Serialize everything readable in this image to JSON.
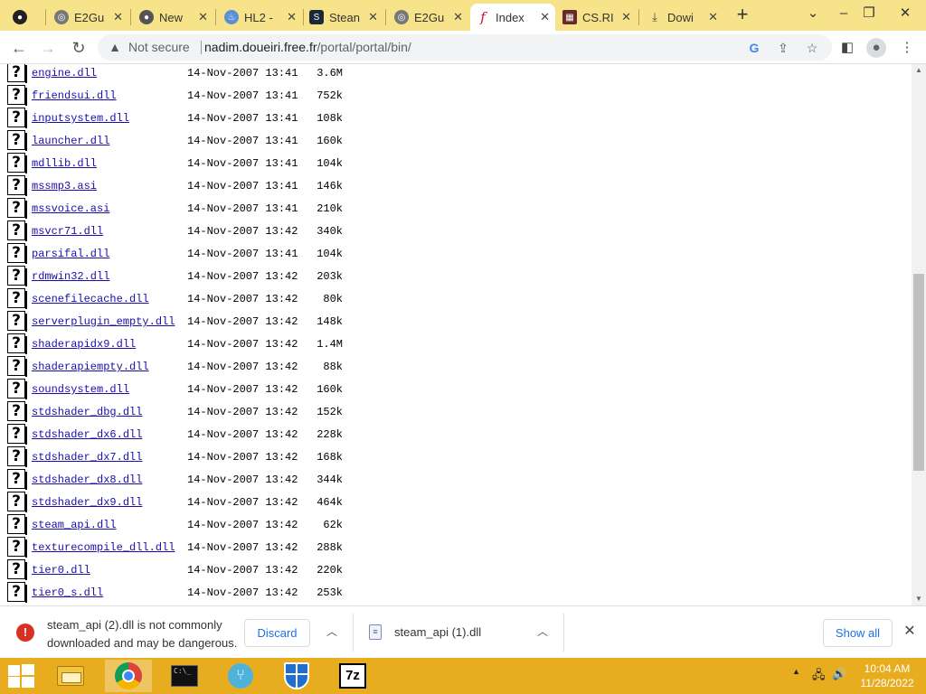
{
  "browser": {
    "tabs": [
      {
        "title": "",
        "icon": "github-icon"
      },
      {
        "title": "E2Gu",
        "icon": "globe-icon"
      },
      {
        "title": "New",
        "icon": "github-icon"
      },
      {
        "title": "HL2 -",
        "icon": "flame-icon"
      },
      {
        "title": "Stean",
        "icon": "steam-icon"
      },
      {
        "title": "E2Gu",
        "icon": "globe-icon"
      },
      {
        "title": "Index",
        "icon": "f-icon"
      },
      {
        "title": "CS.RI",
        "icon": "film-icon"
      },
      {
        "title": "Dowi",
        "icon": "download-icon"
      }
    ],
    "active_tab_index": 6,
    "new_tab_label": "+",
    "address": {
      "security": "Not secure",
      "host": "nadim.doueiri.free.fr",
      "path": "/portal/portal/bin/"
    }
  },
  "listing": [
    {
      "name": "engine.dll",
      "date": "14-Nov-2007 13:41",
      "size": "3.6M"
    },
    {
      "name": "friendsui.dll",
      "date": "14-Nov-2007 13:41",
      "size": "752k"
    },
    {
      "name": "inputsystem.dll",
      "date": "14-Nov-2007 13:41",
      "size": "108k"
    },
    {
      "name": "launcher.dll",
      "date": "14-Nov-2007 13:41",
      "size": "160k"
    },
    {
      "name": "mdllib.dll",
      "date": "14-Nov-2007 13:41",
      "size": "104k"
    },
    {
      "name": "mssmp3.asi",
      "date": "14-Nov-2007 13:41",
      "size": "146k"
    },
    {
      "name": "mssvoice.asi",
      "date": "14-Nov-2007 13:41",
      "size": "210k"
    },
    {
      "name": "msvcr71.dll",
      "date": "14-Nov-2007 13:42",
      "size": "340k"
    },
    {
      "name": "parsifal.dll",
      "date": "14-Nov-2007 13:41",
      "size": "104k"
    },
    {
      "name": "rdmwin32.dll",
      "date": "14-Nov-2007 13:42",
      "size": "203k"
    },
    {
      "name": "scenefilecache.dll",
      "date": "14-Nov-2007 13:42",
      "size": "80k"
    },
    {
      "name": "serverplugin_empty.dll",
      "date": "14-Nov-2007 13:42",
      "size": "148k"
    },
    {
      "name": "shaderapidx9.dll",
      "date": "14-Nov-2007 13:42",
      "size": "1.4M"
    },
    {
      "name": "shaderapiempty.dll",
      "date": "14-Nov-2007 13:42",
      "size": "88k"
    },
    {
      "name": "soundsystem.dll",
      "date": "14-Nov-2007 13:42",
      "size": "160k"
    },
    {
      "name": "stdshader_dbg.dll",
      "date": "14-Nov-2007 13:42",
      "size": "152k"
    },
    {
      "name": "stdshader_dx6.dll",
      "date": "14-Nov-2007 13:42",
      "size": "228k"
    },
    {
      "name": "stdshader_dx7.dll",
      "date": "14-Nov-2007 13:42",
      "size": "168k"
    },
    {
      "name": "stdshader_dx8.dll",
      "date": "14-Nov-2007 13:42",
      "size": "344k"
    },
    {
      "name": "stdshader_dx9.dll",
      "date": "14-Nov-2007 13:42",
      "size": "464k"
    },
    {
      "name": "steam_api.dll",
      "date": "14-Nov-2007 13:42",
      "size": "62k"
    },
    {
      "name": "texturecompile_dll.dll",
      "date": "14-Nov-2007 13:42",
      "size": "288k"
    },
    {
      "name": "tier0.dll",
      "date": "14-Nov-2007 13:42",
      "size": "220k"
    },
    {
      "name": "tier0_s.dll",
      "date": "14-Nov-2007 13:42",
      "size": "253k"
    }
  ],
  "downloads": {
    "warning_line1": "steam_api (2).dll is not commonly",
    "warning_line2": "downloaded and may be dangerous.",
    "discard_label": "Discard",
    "file_name": "steam_api (1).dll",
    "show_all_label": "Show all"
  },
  "taskbar": {
    "time": "10:04 AM",
    "date": "11/28/2022"
  },
  "colors": {
    "tabstrip": "#f7e38a",
    "taskbar": "#e8ad1f",
    "link": "#1a0dab",
    "accent": "#1a73e8"
  }
}
